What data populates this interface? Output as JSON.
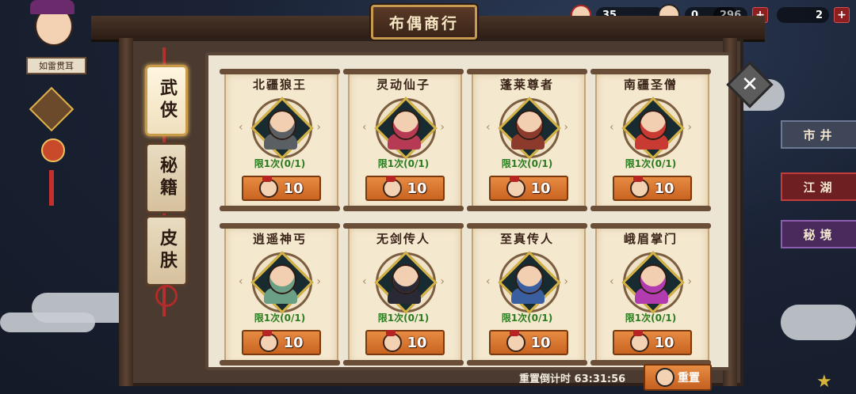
{
  "header": {
    "title": "布偶商行",
    "resources": [
      {
        "name": "puppet-coin",
        "value": "35"
      },
      {
        "name": "gold-coin",
        "value": "0"
      },
      {
        "name": "ingot",
        "value": "296"
      },
      {
        "name": "ticket",
        "value": "2"
      }
    ],
    "player_name": "如雷贯耳"
  },
  "tabs": [
    {
      "label": "武侠",
      "active": true
    },
    {
      "label": "秘籍",
      "active": false
    },
    {
      "label": "皮肤",
      "active": false
    }
  ],
  "items": [
    {
      "name": "北疆狼王",
      "limit": "限1次(0/1)",
      "price": "10",
      "color": "#5a5f64"
    },
    {
      "name": "灵动仙子",
      "limit": "限1次(0/1)",
      "price": "10",
      "color": "#b73a55"
    },
    {
      "name": "蓬莱尊者",
      "limit": "限1次(0/1)",
      "price": "10",
      "color": "#8c3a2c"
    },
    {
      "name": "南疆圣僧",
      "limit": "限1次(0/1)",
      "price": "10",
      "color": "#c83a32"
    },
    {
      "name": "逍遥神丐",
      "limit": "限1次(0/1)",
      "price": "10",
      "color": "#6b9f86"
    },
    {
      "name": "无剑传人",
      "limit": "限1次(0/1)",
      "price": "10",
      "color": "#2a2a36"
    },
    {
      "name": "至真传人",
      "limit": "限1次(0/1)",
      "price": "10",
      "color": "#3a5fa0"
    },
    {
      "name": "峨眉掌门",
      "limit": "限1次(0/1)",
      "price": "10",
      "color": "#b23bb0"
    }
  ],
  "footer": {
    "timer_label": "重置倒计时",
    "timer_value": "63:31:56",
    "reset_label": "重置"
  },
  "side_menu": [
    "市井",
    "江湖",
    "秘境"
  ]
}
